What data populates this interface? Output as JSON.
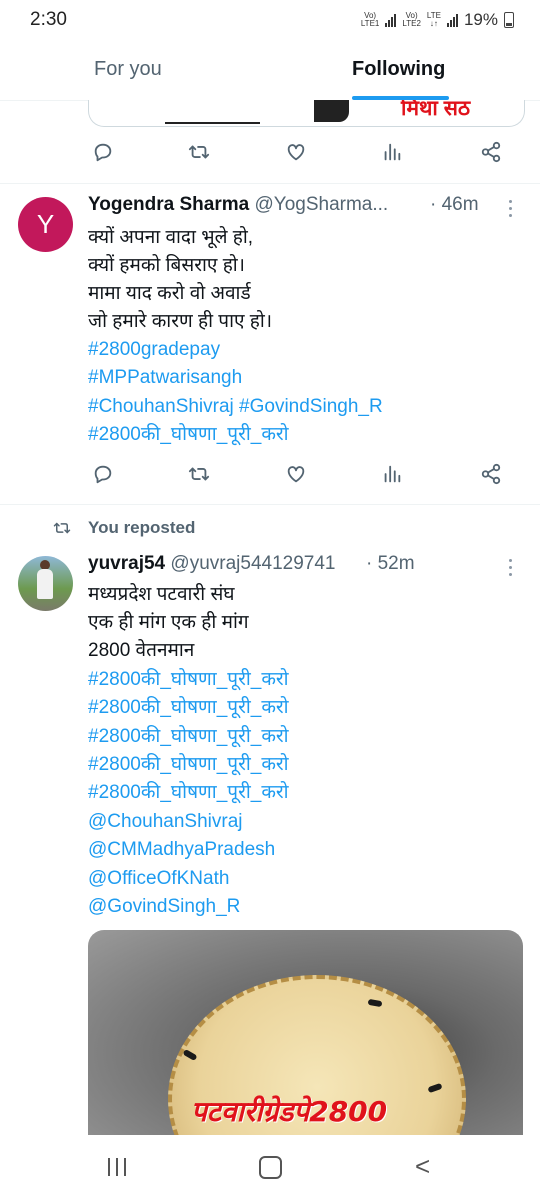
{
  "status_bar": {
    "time": "2:30",
    "sim1_top": "Vo)",
    "sim1_bottom": "LTE1",
    "sim2_top": "Vo)",
    "sim2_bottom": "LTE2",
    "network": "LTE",
    "battery": "19%"
  },
  "tabs": {
    "for_you": "For you",
    "following": "Following",
    "active": "Following"
  },
  "top_media": {
    "visible_text": "मिथा सठ"
  },
  "tweet1": {
    "avatar_letter": "Y",
    "name": "Yogendra Sharma",
    "handle": "@YogSharma...",
    "time": "· 46m",
    "lines": [
      "क्यों अपना वादा भूले हो,",
      "क्यों हमको बिसराए हो।",
      "मामा याद करो वो अवार्ड",
      "जो हमारे कारण ही पाए हो।"
    ],
    "hashtags": [
      "#2800gradepay",
      "#MPPatwarisangh",
      "#ChouhanShivraj #GovindSingh_R",
      "#2800की_घोषणा_पूरी_करो"
    ]
  },
  "repost": {
    "label": "You reposted"
  },
  "tweet2": {
    "name": "yuvraj54",
    "handle": "@yuvraj544129741",
    "time": "· 52m",
    "lines": [
      "मध्यप्रदेश पटवारी संघ",
      "एक ही मांग एक ही मांग",
      "2800 वेतनमान"
    ],
    "hashtags": [
      "#2800की_घोषणा_पूरी_करो",
      " #2800की_घोषणा_पूरी_करो",
      " #2800की_घोषणा_पूरी_करो",
      " #2800की_घोषणा_पूरी_करो",
      " #2800की_घोषणा_पूरी_करो"
    ],
    "mentions": [
      "@ChouhanShivraj",
      "@CMMadhyaPradesh",
      "@OfficeOfKNath",
      "@GovindSingh_R"
    ],
    "image_caption": "पटवारीग्रेडपे2800"
  },
  "colors": {
    "accent": "#1d9bf0",
    "secondary_text": "#536471",
    "avatar_y": "#c2185b",
    "caption_red": "#e0121b"
  },
  "icons": [
    "reply-icon",
    "retweet-icon",
    "like-icon",
    "views-icon",
    "share-icon",
    "more-icon",
    "repost-icon"
  ]
}
